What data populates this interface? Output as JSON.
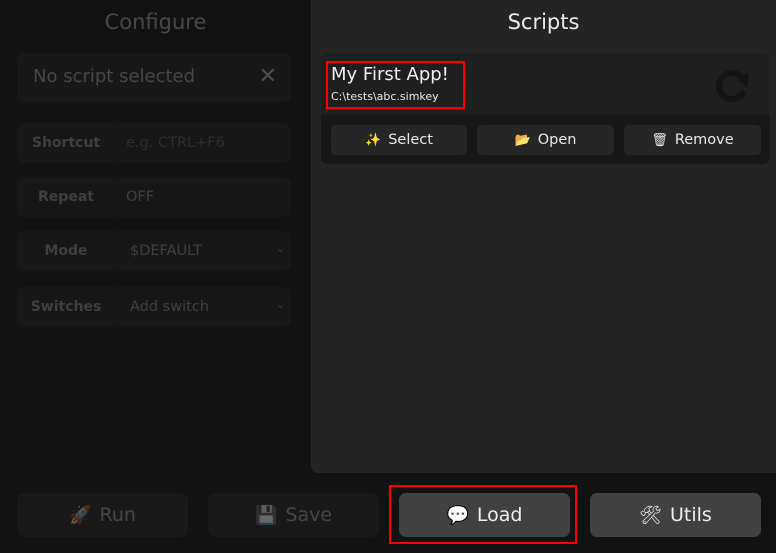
{
  "configure": {
    "title": "Configure",
    "selected_script": "No script selected",
    "close_symbol": "✕",
    "fields": [
      {
        "label": "Shortcut",
        "value": "",
        "placeholder": "e.g. CTRL+F6"
      },
      {
        "label": "Repeat",
        "value": "OFF"
      },
      {
        "label": "Mode",
        "value": "$DEFAULT",
        "dropdown": true
      },
      {
        "label": "Switches",
        "value": "Add switch",
        "dropdown": true
      }
    ]
  },
  "scripts": {
    "title": "Scripts",
    "items": [
      {
        "name": "My First App!",
        "path": "C:\\tests\\abc.simkey",
        "actions": [
          {
            "label": "Select",
            "icon": "✨"
          },
          {
            "label": "Open",
            "icon": "📂"
          },
          {
            "label": "Remove",
            "icon": "🗑"
          }
        ]
      }
    ]
  },
  "bottom_buttons": [
    {
      "label": "Run",
      "icon": "🚀",
      "enabled": false
    },
    {
      "label": "Save",
      "icon": "💾",
      "enabled": false
    },
    {
      "label": "Load",
      "icon": "💬",
      "enabled": true
    },
    {
      "label": "Utils",
      "icon": "🛠",
      "enabled": true
    }
  ],
  "chevron_symbol": "⌄",
  "colors": {
    "highlight": "#ff0000",
    "panel_right": "#242424",
    "background": "#121212"
  }
}
